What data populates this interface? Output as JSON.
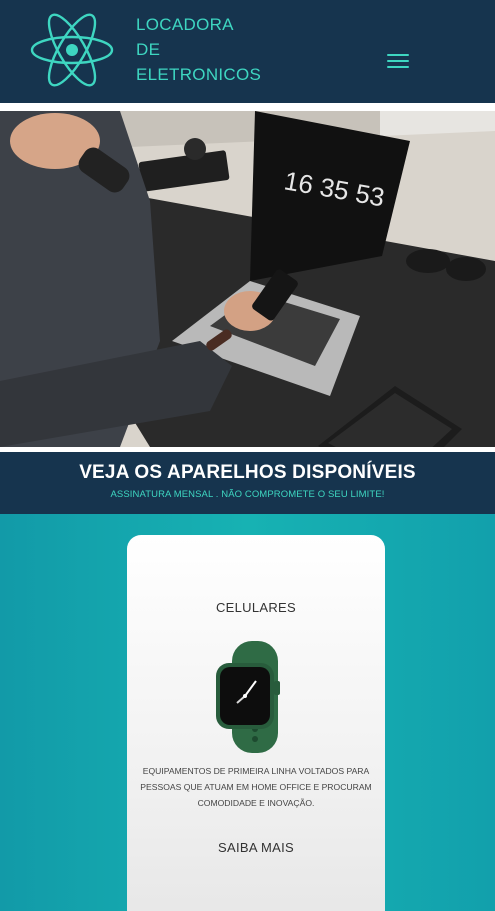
{
  "header": {
    "brand_line1": "LOCADORA",
    "brand_line2": "DE",
    "brand_line3": "ELETRONICOS",
    "logo_icon": "atom-icon",
    "menu_icon": "hamburger-menu-icon"
  },
  "hero": {
    "clock_text": "16 35 53"
  },
  "banner": {
    "title": "VEJA OS APARELHOS DISPONÍVEIS",
    "subtitle": "ASSINATURA MENSAL . NÃO COMPROMETE O SEU LIMITE!"
  },
  "card": {
    "title": "CELULARES",
    "description": "EQUIPAMENTOS DE PRIMEIRA LINHA VOLTADOS PARA PESSOAS QUE ATUAM EM HOME OFFICE E PROCURAM COMODIDADE E INOVAÇÃO.",
    "link_label": "SAIBA MAIS",
    "image_icon": "smartwatch-icon"
  },
  "colors": {
    "navy": "#16344e",
    "accent": "#3ed6c1",
    "teal": "#17b2b3"
  }
}
